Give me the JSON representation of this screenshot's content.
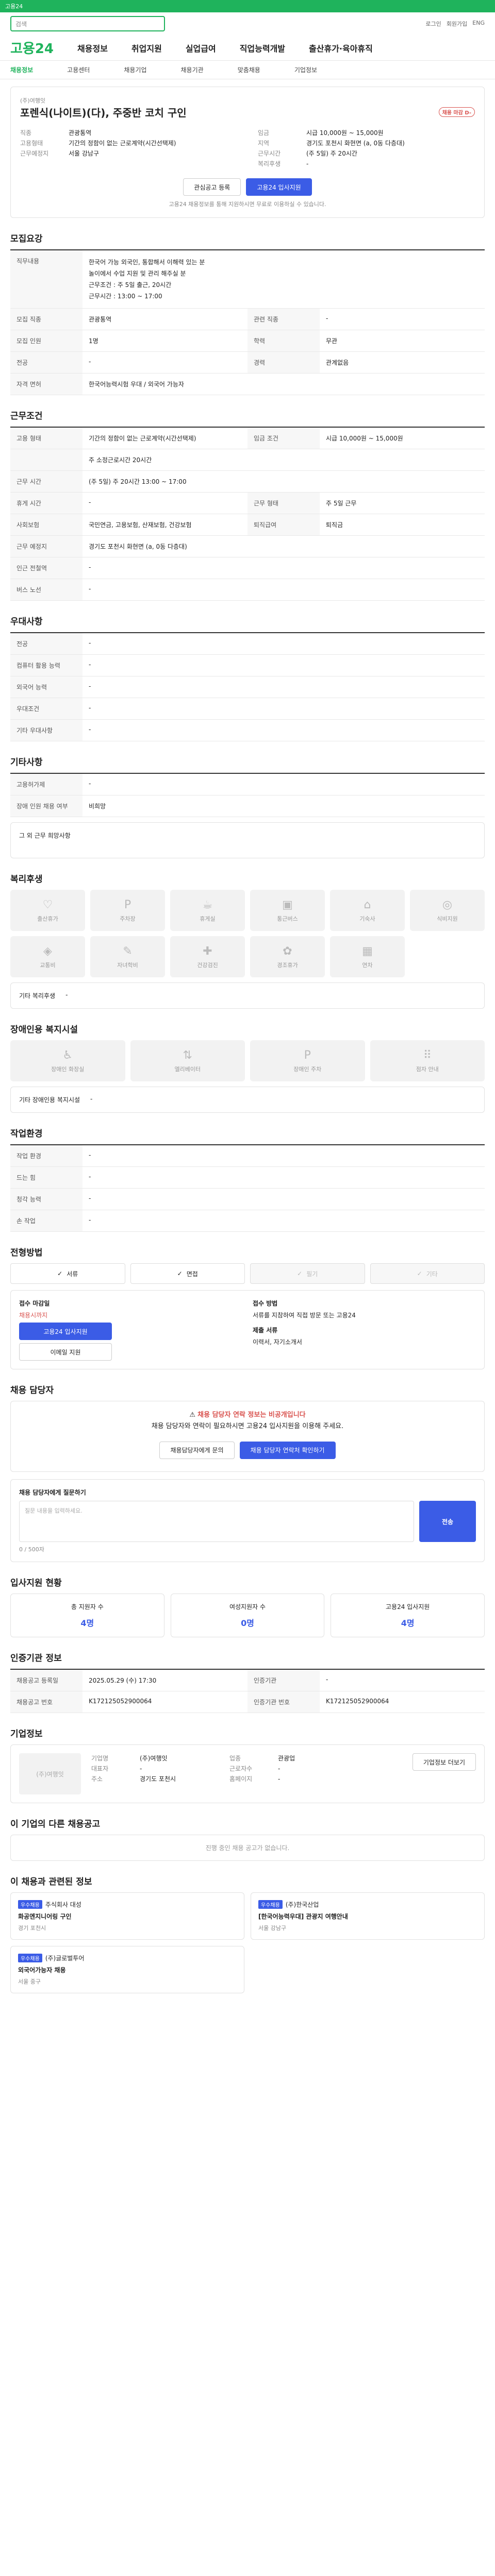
{
  "topbar": {
    "text": "고용24"
  },
  "search": {
    "placeholder": "검색"
  },
  "utils": [
    "로그인",
    "회원가입",
    "ENG"
  ],
  "gnb": {
    "logo": "고용24",
    "items": [
      "채용정보",
      "취업지원",
      "실업급여",
      "직업능력개발",
      "출산휴가·육아휴직"
    ]
  },
  "subnav": [
    "채용정보",
    "고용센터",
    "채용기업",
    "채용기관",
    "맞춤채용",
    "기업정보"
  ],
  "job": {
    "company": "(주)여행잇",
    "title": "포렌식(나이트)(다), 주중반 코치 구인",
    "badge": "채용 마감 D-",
    "left": [
      [
        "직종",
        "관광통역"
      ],
      [
        "고용형태",
        "기간의 정함이 없는 근로계약(시간선택제)"
      ],
      [
        "근무예정지",
        "서울 강남구"
      ]
    ],
    "right": [
      [
        "임금",
        "시급 10,000원 ~ 15,000원"
      ],
      [
        "지역",
        "경기도 포천시 화현면 (a, 0동 다층대)"
      ],
      [
        "근무시간",
        "(주 5일) 주 20시간"
      ],
      [
        "복리후생",
        "-"
      ]
    ],
    "notice": "고용24 채용정보를 통해 지원하시면 무료로 이용하실 수 있습니다.",
    "btn_scrap": "관심공고 등록",
    "btn_apply": "고용24 입사지원"
  },
  "recruit": {
    "h": "모집요강",
    "desc_title": "직무내용",
    "desc": [
      "한국어 가능 외국인, 통합해서 이해력 있는 분",
      "놀이에서 수업 지원 및 관리 해주실 분",
      "근무조건 : 주 5일 출근, 20시간",
      "근무시간 : 13:00 ~ 17:00"
    ],
    "rows": [
      [
        "모집 직종",
        "관광통역",
        "관련 직종",
        "-"
      ],
      [
        "모집 인원",
        "1명",
        "학력",
        "무관"
      ],
      [
        "전공",
        "-",
        "경력",
        "관계없음"
      ],
      [
        "자격 면허",
        "한국어능력시험 우대 / 외국어 가능자",
        "",
        ""
      ]
    ]
  },
  "conditions": {
    "h": "근무조건",
    "rows": [
      [
        "고용 형태",
        "기간의 정함이 없는 근로계약(시간선택제)",
        "임금 조건",
        "시급 10,000원 ~ 15,000원"
      ],
      [
        "",
        "주 소정근로시간 20시간",
        "",
        ""
      ],
      [
        "근무 시간",
        "(주 5일) 주 20시간 13:00 ~ 17:00",
        "",
        ""
      ],
      [
        "휴게 시간",
        "-",
        "근무 형태",
        "주 5일 근무"
      ],
      [
        "사회보험",
        "국민연금, 고용보험, 산재보험, 건강보험",
        "퇴직급여",
        "퇴직금"
      ],
      [
        "근무 예정지",
        "경기도 포천시 화현면 (a, 0동 다층대)",
        "",
        ""
      ],
      [
        "인근 전철역",
        "-",
        "",
        ""
      ],
      [
        "버스 노선",
        "-",
        "",
        ""
      ]
    ]
  },
  "preference": {
    "h": "우대사항",
    "rows": [
      [
        "전공",
        "-"
      ],
      [
        "컴퓨터 활용 능력",
        "-"
      ],
      [
        "외국어 능력",
        "-"
      ],
      [
        "우대조건",
        "-"
      ],
      [
        "기타 우대사항",
        "-"
      ]
    ]
  },
  "other": {
    "h": "기타사항",
    "rows": [
      [
        "고용허가제",
        "-"
      ],
      [
        "장애 인원 채용 여부",
        "비희망"
      ]
    ],
    "note": "그 외 근무 희망사항"
  },
  "welfare": {
    "h": "복리후생",
    "items": [
      "출산휴가",
      "주차장",
      "휴게실",
      "통근버스",
      "기숙사",
      "식비지원",
      "교통비",
      "자녀학비",
      "건강검진",
      "경조휴가",
      "연차"
    ],
    "extra_label": "기타 복리후생",
    "extra_value": "-"
  },
  "disability": {
    "h": "장애인용 복지시설",
    "items": [
      "장애인 화장실",
      "엘리베이터",
      "장애인 주차",
      "점자 안내"
    ],
    "extra_label": "기타 장애인용 복지시설",
    "extra_value": "-"
  },
  "env": {
    "h": "작업환경",
    "rows": [
      [
        "작업 환경",
        "-",
        "",
        ""
      ],
      [
        "드는 힘",
        "-",
        "",
        ""
      ],
      [
        "청각 능력",
        "-",
        "",
        ""
      ],
      [
        "손 작업",
        "-",
        "",
        ""
      ]
    ]
  },
  "apply_method": {
    "h": "전형방법",
    "types": [
      "서류",
      "면접",
      "필기",
      "기타"
    ],
    "receipt": "접수 마감일",
    "deadline": "채용시까지",
    "method_label": "접수 방법",
    "method": "서류를 지참하여 직접 방문 또는 고용24",
    "docs_label": "제출 서류",
    "docs": "이력서, 자기소개서",
    "apply_btn": "고용24 입사지원",
    "print_btn": "이메일 지원"
  },
  "contact": {
    "h": "채용 담당자",
    "alert_title": "채용 담당자 연락 정보는 비공개입니다",
    "alert_sub": "채용 담당자와 연락이 필요하시면 고용24 입사지원을 이용해 주세요.",
    "btn1": "채용담당자에게 문의",
    "btn2": "채용 담당자 연락처 확인하기"
  },
  "question": {
    "h": "채용 담당자에게 질문하기",
    "placeholder": "질문 내용을 입력하세요.",
    "btn": "전송",
    "counter": "0 / 500자"
  },
  "applicants": {
    "h": "입사지원 현황",
    "cards": [
      [
        "총 지원자 수",
        "4명"
      ],
      [
        "여성지원자 수",
        "0명"
      ],
      [
        "고용24 입사지원",
        "4명"
      ]
    ]
  },
  "info": {
    "h": "인증기관 정보",
    "rows": [
      [
        "채용공고 등록일",
        "2025.05.29 (수) 17:30",
        "인증기관",
        "-"
      ],
      [
        "채용공고 번호",
        "K172125052900064",
        "인증기관 번호",
        "K172125052900064"
      ]
    ]
  },
  "company": {
    "h": "기업정보",
    "name": "(주)여행잇",
    "rows": [
      [
        "기업명",
        "(주)여행잇",
        "업종",
        "관광업"
      ],
      [
        "대표자",
        "-",
        "근로자수",
        "-"
      ],
      [
        "주소",
        "경기도 포천시",
        "홈페이지",
        "-"
      ]
    ],
    "btn": "기업정보 더보기"
  },
  "other_jobs": {
    "h": "이 기업의 다른 채용공고",
    "empty": "진행 중인 채용 공고가 없습니다."
  },
  "related": {
    "h": "이 채용과 관련된 정보",
    "items": [
      [
        "우수채용",
        "주식회사 대성",
        "화공엔지니어링 구인",
        "경기 포천시"
      ],
      [
        "우수채용",
        "(주)한국산업",
        "[한국어능력우대] 관광지 여행안내",
        "서울 강남구"
      ],
      [
        "우수채용",
        "(주)글로벌투어",
        "외국어가능자 채용",
        "서울 중구"
      ]
    ]
  }
}
